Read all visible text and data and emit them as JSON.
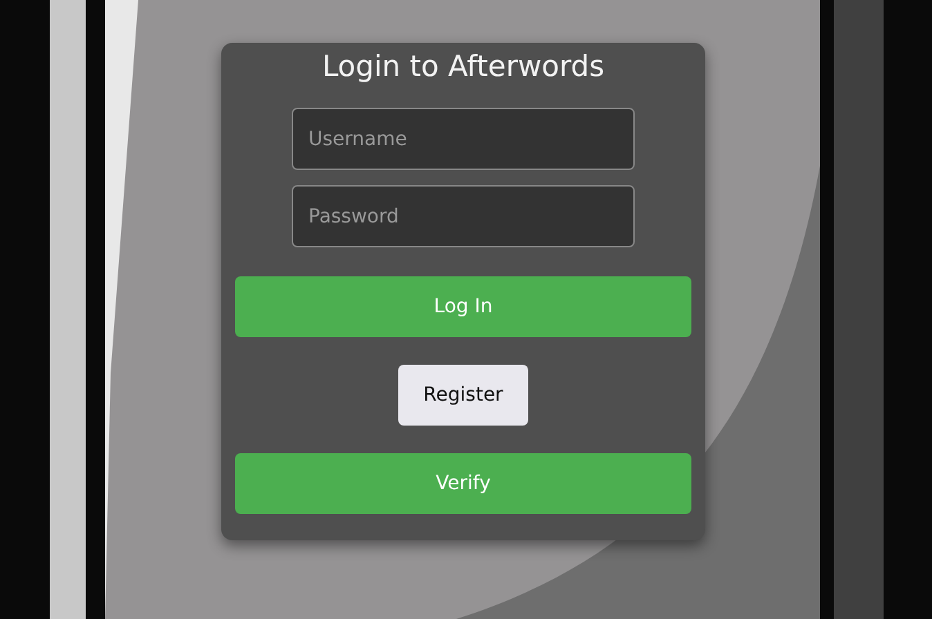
{
  "login_card": {
    "title": "Login to Afterwords",
    "fields": [
      {
        "placeholder": "Username"
      },
      {
        "placeholder": "Password"
      }
    ],
    "buttons": [
      {
        "label": "Log In",
        "kind": "primary"
      },
      {
        "label": "Register",
        "kind": "secondary"
      },
      {
        "label": "Verify",
        "kind": "primary"
      }
    ]
  }
}
